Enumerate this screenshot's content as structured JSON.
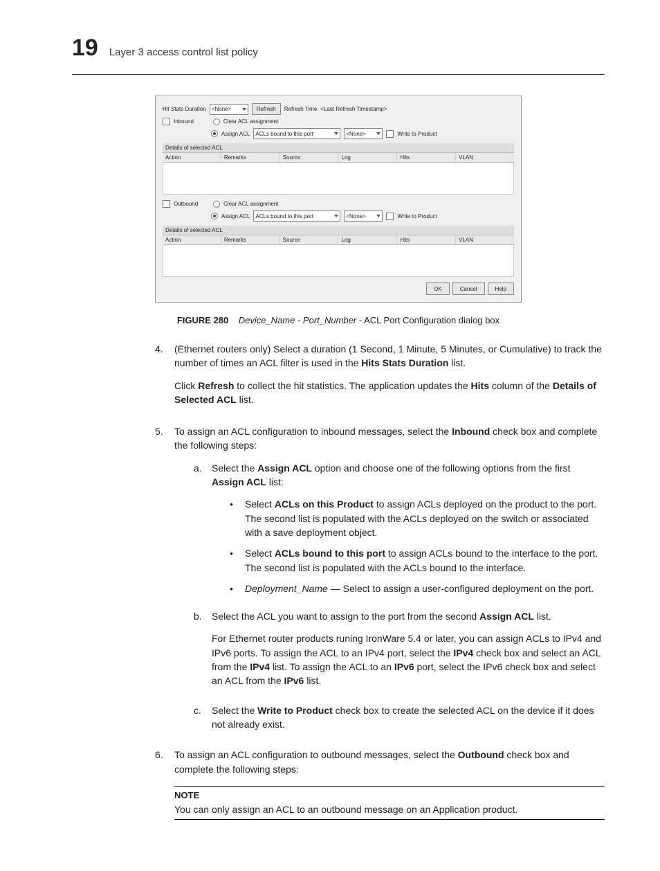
{
  "chapter": {
    "number": "19",
    "title": "Layer 3 access control list policy"
  },
  "dialog": {
    "hitStatsLabel": "Hit Stats Duration",
    "hitStatsValue": "<None>",
    "refreshBtn": "Refresh",
    "refreshTimeLabel": "Refresh Time",
    "refreshTimeValue": "<Last Refresh Timestamp>",
    "inbound": {
      "checkboxLabel": "Inbound",
      "clearLabel": "Clear ACL assignment",
      "assignLabel": "Assign ACL",
      "assignSel1": "ACLs bound to this port",
      "assignSel2": "<None>",
      "writeLabel": "Write to Product",
      "sectionHdr": "Details of selected ACL",
      "cols": [
        "Action",
        "Remarks",
        "Source",
        "Log",
        "Hits",
        "VLAN"
      ]
    },
    "outbound": {
      "checkboxLabel": "Outbound",
      "clearLabel": "Clear ACL assignment",
      "assignLabel": "Assign ACL",
      "assignSel1": "ACLs bound to this port",
      "assignSel2": "<None>",
      "writeLabel": "Write to Product",
      "sectionHdr": "Details of selected ACL",
      "cols": [
        "Action",
        "Remarks",
        "Source",
        "Log",
        "Hits",
        "VLAN"
      ]
    },
    "footer": {
      "ok": "OK",
      "cancel": "Cancel",
      "help": "Help"
    }
  },
  "figure": {
    "lead": "FIGURE 280",
    "italic": "Device_Name - Port_Number",
    "tail": " - ACL Port Configuration dialog box"
  },
  "steps": {
    "s4": {
      "num": "4.",
      "p1a": "(Ethernet routers only) Select a duration (1 Second, 1 Minute, 5 Minutes, or Cumulative) to track the number of times an ACL filter is used in the ",
      "p1b": "Hits Stats Duration",
      "p1c": " list.",
      "p2a": "Click ",
      "p2b": "Refresh",
      "p2c": " to collect the hit statistics. The application updates the ",
      "p2d": "Hits",
      "p2e": " column of the ",
      "p2f": "Details of Selected ACL",
      "p2g": " list."
    },
    "s5": {
      "num": "5.",
      "intro_a": "To assign an ACL configuration to inbound messages, select the ",
      "intro_b": "Inbound",
      "intro_c": " check box and complete the following steps:",
      "a": {
        "lab": "a.",
        "t1": "Select the ",
        "t2": "Assign ACL",
        "t3": " option and choose one of the following options from the first ",
        "t4": "Assign ACL",
        "t5": " list:",
        "bul1_a": "Select ",
        "bul1_b": "ACLs on this Product",
        "bul1_c": " to assign ACLs deployed on the product to the port. The second list is populated with the ACLs deployed on the switch or associated with a save deployment object.",
        "bul2_a": "Select ",
        "bul2_b": "ACLs bound to this port",
        "bul2_c": " to assign ACLs bound to the interface to the port. The second list is populated with the ACLs bound to the interface.",
        "bul3_a": "Deployment_Name",
        "bul3_b": " — Select to assign a user-configured deployment on the port."
      },
      "b": {
        "lab": "b.",
        "t1": "Select the ACL you want to assign to the port from the second ",
        "t2": "Assign ACL",
        "t3": " list.",
        "p2_a": "For Ethernet router products runing IronWare 5.4 or later, you can assign ACLs to IPv4 and IPv6 ports. To assign the ACL to an IPv4 port, select the ",
        "p2_b": "IPv4",
        "p2_c": " check box and select an ACL from the ",
        "p2_d": "IPv4",
        "p2_e": " list. To assign the ACL to an ",
        "p2_f": "IPv6",
        "p2_g": " port, select the IPv6 check box and select an ACL from the ",
        "p2_h": "IPv6",
        "p2_i": " list."
      },
      "c": {
        "lab": "c.",
        "t1": "Select the ",
        "t2": "Write to Product",
        "t3": " check box to create the selected ACL on the device if it does not already exist."
      }
    },
    "s6": {
      "num": "6.",
      "a": "To assign an ACL configuration to outbound messages, select the ",
      "b": "Outbound",
      "c": " check box and complete the following steps:"
    }
  },
  "note": {
    "title": "NOTE",
    "body": "You can only assign an ACL to an outbound message on an Application product."
  }
}
